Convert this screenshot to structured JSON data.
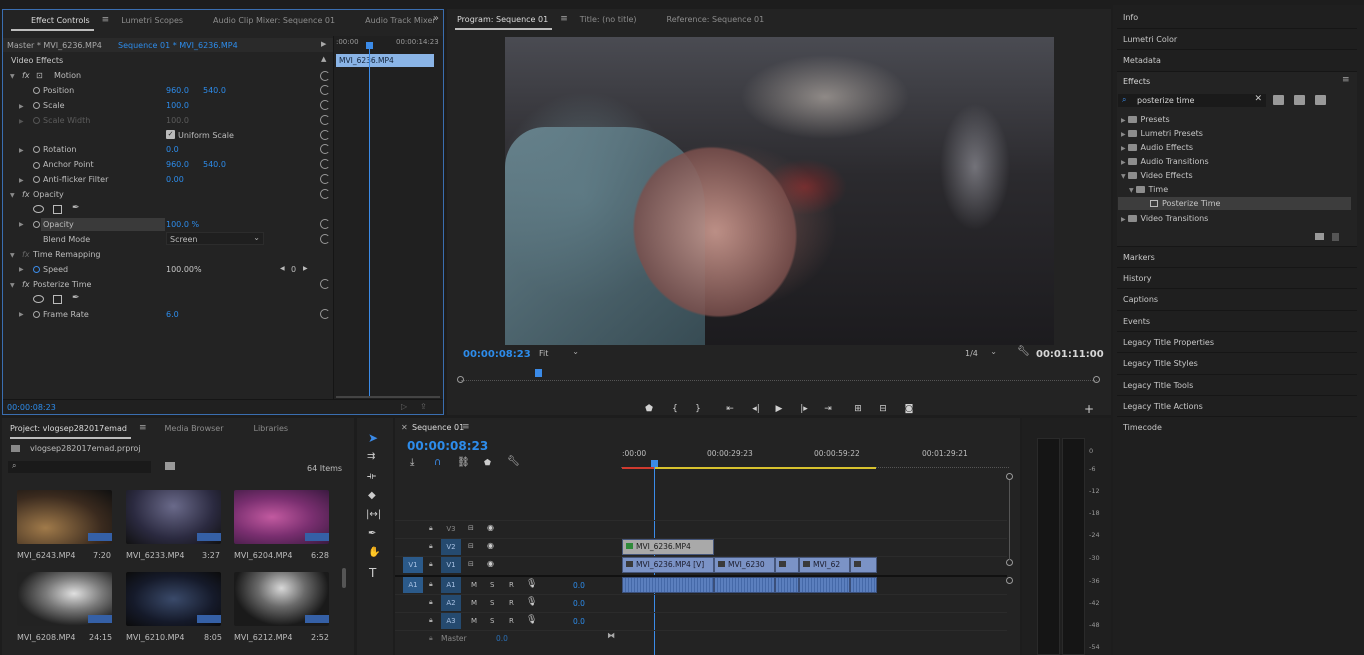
{
  "effect_controls": {
    "tabs": [
      "Effect Controls",
      "Lumetri Scopes",
      "Audio Clip Mixer: Sequence 01",
      "Audio Track Mixer"
    ],
    "master_label": "Master * MVI_6236.MP4",
    "sequence_label": "Sequence 01 * MVI_6236.MP4",
    "mini_ruler_start": ":00:00",
    "mini_ruler_end": "00:00:14:23",
    "clip_name": "MVI_6236.MP4",
    "section_video": "Video Effects",
    "motion": {
      "label": "Motion",
      "position_label": "Position",
      "position_x": "960.0",
      "position_y": "540.0",
      "scale_label": "Scale",
      "scale_value": "100.0",
      "scale_width_label": "Scale Width",
      "scale_width_value": "100.0",
      "uniform_scale_label": "Uniform Scale",
      "rotation_label": "Rotation",
      "rotation_value": "0.0",
      "anchor_label": "Anchor Point",
      "anchor_x": "960.0",
      "anchor_y": "540.0",
      "antiflicker_label": "Anti-flicker Filter",
      "antiflicker_value": "0.00"
    },
    "opacity": {
      "label": "Opacity",
      "opacity_label": "Opacity",
      "opacity_value": "100.0 %",
      "blend_label": "Blend Mode",
      "blend_value": "Screen"
    },
    "time_remapping": {
      "label": "Time Remapping",
      "speed_label": "Speed",
      "speed_value": "100.00%",
      "keyframe_value": "0"
    },
    "posterize": {
      "label": "Posterize Time",
      "frame_rate_label": "Frame Rate",
      "frame_rate_value": "6.0"
    },
    "timecode": "00:00:08:23"
  },
  "program_monitor": {
    "tabs": [
      "Program: Sequence 01",
      "Title: (no title)",
      "Reference: Sequence 01"
    ],
    "timecode": "00:00:08:23",
    "fit_label": "Fit",
    "resolution": "1/4",
    "duration": "00:01:11:00"
  },
  "project": {
    "tabs": [
      "Project: vlogsep282017emad",
      "Media Browser",
      "Libraries"
    ],
    "file_name": "vlogsep282017emad.prproj",
    "search_placeholder": "",
    "items_count": "64 Items",
    "items": [
      {
        "name": "MVI_6243.MP4",
        "duration": "7:20"
      },
      {
        "name": "MVI_6233.MP4",
        "duration": "3:27"
      },
      {
        "name": "MVI_6204.MP4",
        "duration": "6:28"
      },
      {
        "name": "MVI_6208.MP4",
        "duration": "24:15"
      },
      {
        "name": "MVI_6210.MP4",
        "duration": "8:05"
      },
      {
        "name": "MVI_6212.MP4",
        "duration": "2:52"
      }
    ]
  },
  "timeline": {
    "tab": "Sequence 01",
    "timecode": "00:00:08:23",
    "ruler": [
      ":00:00",
      "00:00:29:23",
      "00:00:59:22",
      "00:01:29:21"
    ],
    "tracks": {
      "v3": "V3",
      "v2": "V2",
      "v1": "V1",
      "a1": "A1",
      "a2": "A2",
      "a3": "A3",
      "src_v1": "V1",
      "src_a1": "A1",
      "m": "M",
      "s": "S",
      "r": "R",
      "a1_vol": "0.0",
      "a2_vol": "0.0",
      "a3_vol": "0.0",
      "master_label": "Master",
      "master_vol": "0.0"
    },
    "clips": {
      "v2_clip": "MVI_6236.MP4",
      "v1_clip1": "MVI_6236.MP4 [V]",
      "v1_clip2": "MVI_6230",
      "v1_clip3": "MVI_62"
    }
  },
  "audio_meter": {
    "labels": [
      "0",
      "-6",
      "-12",
      "-18",
      "-24",
      "-30",
      "-36",
      "-42",
      "-48",
      "-54"
    ]
  },
  "right_panel": {
    "top_items": [
      "Info",
      "Lumetri Color",
      "Metadata"
    ],
    "effects_title": "Effects",
    "search_value": "posterize time",
    "tree": {
      "presets": "Presets",
      "lumetri_presets": "Lumetri Presets",
      "audio_effects": "Audio Effects",
      "audio_transitions": "Audio Transitions",
      "video_effects": "Video Effects",
      "time": "Time",
      "posterize_time": "Posterize Time",
      "video_transitions": "Video Transitions"
    },
    "bottom_items": [
      "Markers",
      "History",
      "Captions",
      "Events",
      "Legacy Title Properties",
      "Legacy Title Styles",
      "Legacy Title Tools",
      "Legacy Title Actions",
      "Timecode"
    ]
  },
  "colors": {
    "accent_blue": "#2d8ceb",
    "playhead": "#3b8be8",
    "clip_video": "#7b93c6",
    "clip_audio": "#6183c0",
    "work_area_yellow": "#d7c22e",
    "work_area_red": "#d03a2f"
  }
}
